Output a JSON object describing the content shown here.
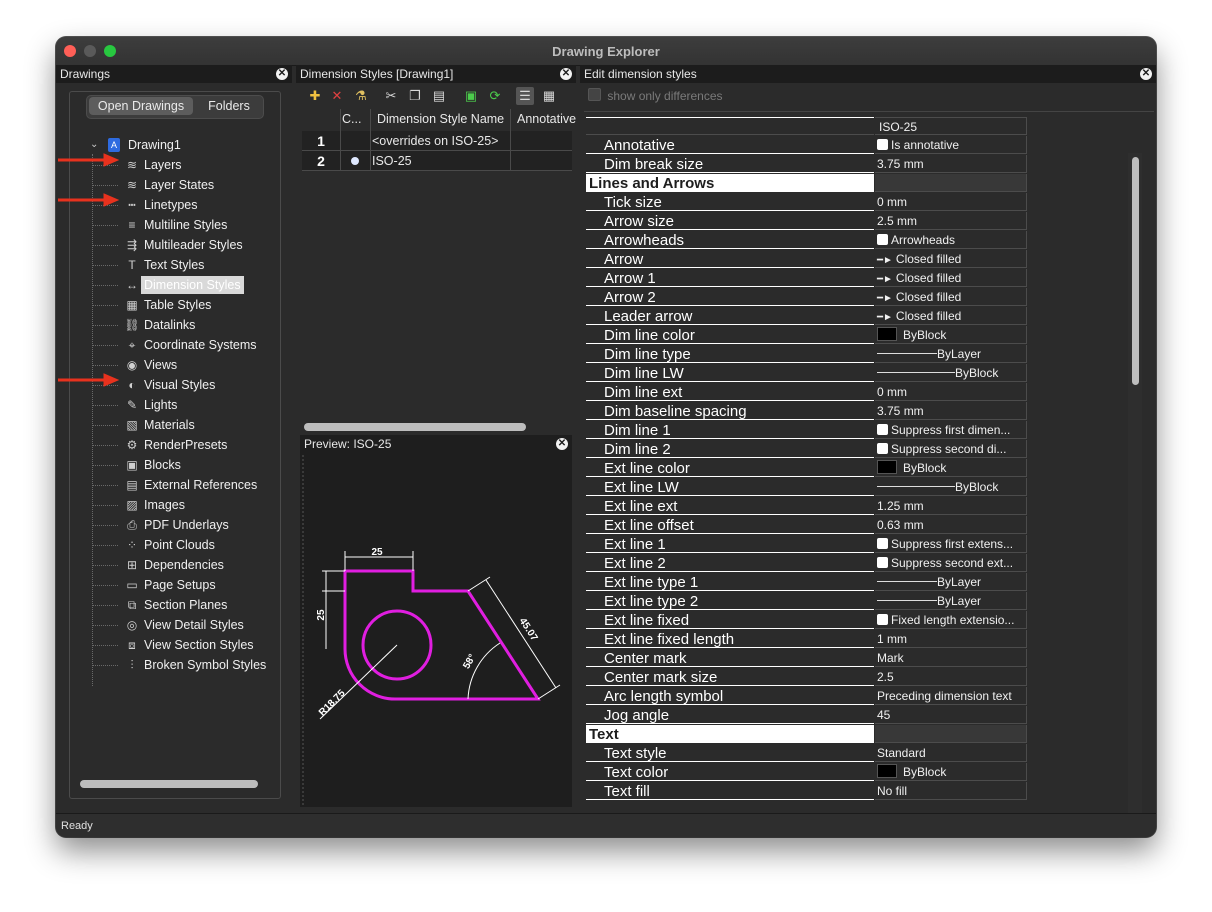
{
  "window": {
    "title": "Drawing Explorer"
  },
  "status": {
    "text": "Ready"
  },
  "left_panel": {
    "title": "Drawings",
    "tabs": [
      "Open Drawings",
      "Folders"
    ],
    "root": "Drawing1",
    "items": [
      {
        "label": "Layers",
        "icon": "layers-icon"
      },
      {
        "label": "Layer States",
        "icon": "layer-states-icon"
      },
      {
        "label": "Linetypes",
        "icon": "linetypes-icon"
      },
      {
        "label": "Multiline Styles",
        "icon": "multiline-icon"
      },
      {
        "label": "Multileader Styles",
        "icon": "multileader-icon"
      },
      {
        "label": "Text Styles",
        "icon": "text-styles-icon"
      },
      {
        "label": "Dimension Styles",
        "icon": "dimension-styles-icon"
      },
      {
        "label": "Table Styles",
        "icon": "table-styles-icon"
      },
      {
        "label": "Datalinks",
        "icon": "datalinks-icon"
      },
      {
        "label": "Coordinate Systems",
        "icon": "coordinate-systems-icon"
      },
      {
        "label": "Views",
        "icon": "views-icon"
      },
      {
        "label": "Visual Styles",
        "icon": "visual-styles-icon"
      },
      {
        "label": "Lights",
        "icon": "lights-icon"
      },
      {
        "label": "Materials",
        "icon": "materials-icon"
      },
      {
        "label": "RenderPresets",
        "icon": "render-presets-icon"
      },
      {
        "label": "Blocks",
        "icon": "blocks-icon"
      },
      {
        "label": "External References",
        "icon": "external-references-icon"
      },
      {
        "label": "Images",
        "icon": "images-icon"
      },
      {
        "label": "PDF Underlays",
        "icon": "pdf-underlays-icon"
      },
      {
        "label": "Point Clouds",
        "icon": "point-clouds-icon"
      },
      {
        "label": "Dependencies",
        "icon": "dependencies-icon"
      },
      {
        "label": "Page Setups",
        "icon": "page-setups-icon"
      },
      {
        "label": "Section Planes",
        "icon": "section-planes-icon"
      },
      {
        "label": "View Detail Styles",
        "icon": "view-detail-icon"
      },
      {
        "label": "View Section Styles",
        "icon": "view-section-icon"
      },
      {
        "label": "Broken Symbol Styles",
        "icon": "broken-symbol-icon"
      }
    ],
    "arrow_color": "#e8321e"
  },
  "mid_panel": {
    "title": "Dimension Styles [Drawing1]",
    "columns": [
      "C...",
      "Dimension Style Name",
      "Annotative"
    ],
    "rows": [
      {
        "num": "1",
        "name": "<overrides on ISO-25>"
      },
      {
        "num": "2",
        "name": "ISO-25"
      }
    ],
    "preview_title": "Preview: ISO-25",
    "preview_labels": {
      "top": "25",
      "left": "25",
      "slant": "45.07",
      "angle": "58°",
      "radius": "R18.75"
    },
    "accent": "#e01ee0"
  },
  "right_panel": {
    "title": "Edit dimension styles",
    "show_diff": "show only differences",
    "column_value": "ISO-25",
    "rows": [
      {
        "name": "Annotative",
        "value": "Is annotative",
        "kind": "check"
      },
      {
        "name": "Dim break size",
        "value": "3.75 mm"
      },
      {
        "name": "Lines and Arrows",
        "value": "",
        "kind": "cat"
      },
      {
        "name": "Tick size",
        "value": "0 mm"
      },
      {
        "name": "Arrow size",
        "value": "2.5 mm"
      },
      {
        "name": "Arrowheads",
        "value": "Arrowheads",
        "kind": "check"
      },
      {
        "name": "Arrow",
        "value": "Closed filled",
        "kind": "arrow"
      },
      {
        "name": "Arrow 1",
        "value": "Closed filled",
        "kind": "arrow"
      },
      {
        "name": "Arrow 2",
        "value": "Closed filled",
        "kind": "arrow"
      },
      {
        "name": "Leader arrow",
        "value": "Closed filled",
        "kind": "arrow"
      },
      {
        "name": "Dim line color",
        "value": "ByBlock",
        "kind": "color"
      },
      {
        "name": "Dim line type",
        "value": "ByLayer",
        "kind": "line1"
      },
      {
        "name": "Dim line LW",
        "value": "ByBlock",
        "kind": "line2"
      },
      {
        "name": "Dim line ext",
        "value": "0 mm"
      },
      {
        "name": "Dim baseline spacing",
        "value": "3.75 mm"
      },
      {
        "name": "Dim line 1",
        "value": "Suppress first dimen...",
        "kind": "check"
      },
      {
        "name": "Dim line 2",
        "value": "Suppress second di...",
        "kind": "check"
      },
      {
        "name": "Ext line color",
        "value": "ByBlock",
        "kind": "color"
      },
      {
        "name": "Ext line LW",
        "value": "ByBlock",
        "kind": "line2"
      },
      {
        "name": "Ext line ext",
        "value": "1.25 mm"
      },
      {
        "name": "Ext line offset",
        "value": "0.63 mm"
      },
      {
        "name": "Ext line 1",
        "value": "Suppress first extens...",
        "kind": "check"
      },
      {
        "name": "Ext line 2",
        "value": "Suppress second ext...",
        "kind": "check"
      },
      {
        "name": "Ext line type 1",
        "value": "ByLayer",
        "kind": "line1"
      },
      {
        "name": "Ext line type 2",
        "value": "ByLayer",
        "kind": "line1"
      },
      {
        "name": "Ext line fixed",
        "value": "Fixed length extensio...",
        "kind": "check"
      },
      {
        "name": "Ext line fixed length",
        "value": "1 mm"
      },
      {
        "name": "Center mark",
        "value": "Mark"
      },
      {
        "name": "Center mark size",
        "value": "2.5"
      },
      {
        "name": "Arc length symbol",
        "value": "Preceding dimension text"
      },
      {
        "name": "Jog angle",
        "value": "45"
      },
      {
        "name": "Text",
        "value": "",
        "kind": "cat"
      },
      {
        "name": "Text style",
        "value": "Standard"
      },
      {
        "name": "Text color",
        "value": "ByBlock",
        "kind": "color"
      },
      {
        "name": "Text fill",
        "value": "No fill"
      }
    ]
  }
}
